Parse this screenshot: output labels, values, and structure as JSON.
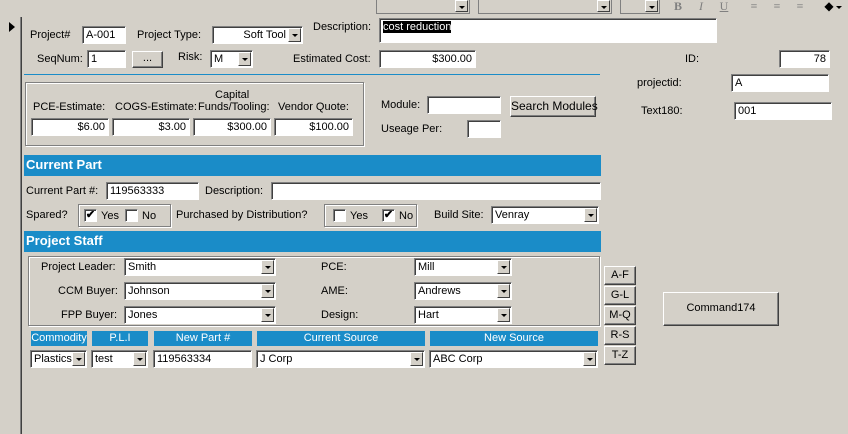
{
  "project": {
    "number_label": "Project#",
    "number": "A-001",
    "type_label": "Project Type:",
    "type": "Soft Tool",
    "description_label": "Description:",
    "description": "cost reduction",
    "seqnum_label": "SeqNum:",
    "seqnum": "1",
    "seq_button": "...",
    "risk_label": "Risk:",
    "risk": "M",
    "estimated_cost_label": "Estimated Cost:",
    "estimated_cost": "$300.00"
  },
  "right_panel": {
    "id_label": "ID:",
    "id": "78",
    "projectid_label": "projectid:",
    "projectid": "A",
    "text180_label": "Text180:",
    "text180": "001",
    "command_button": "Command174"
  },
  "estimates": {
    "pce_label": "PCE-Estimate:",
    "pce": "$6.00",
    "cogs_label": "COGS-Estimate:",
    "cogs": "$3.00",
    "capital_label_1": "Capital",
    "capital_label_2": "Funds/Tooling:",
    "capital": "$300.00",
    "vendor_label": "Vendor Quote:",
    "vendor": "$100.00"
  },
  "module": {
    "module_label": "Module:",
    "module": "",
    "search_button": "Search Modules",
    "useage_label": "Useage Per:",
    "useage": ""
  },
  "current_part": {
    "header": "Current Part",
    "part_label": "Current Part #:",
    "part": "119563333",
    "description_label": "Description:",
    "description": "",
    "spared_label": "Spared?",
    "spared_yes": "Yes",
    "spared_no": "No",
    "spared_yes_checked": "✔",
    "spared_no_checked": "",
    "purchased_label": "Purchased by Distribution?",
    "purchased_yes": "Yes",
    "purchased_no": "No",
    "purchased_yes_checked": "",
    "purchased_no_checked": "✔",
    "build_site_label": "Build Site:",
    "build_site": "Venray"
  },
  "staff": {
    "header": "Project Staff",
    "leader_label": "Project Leader:",
    "leader": "Smith",
    "ccm_label": "CCM Buyer:",
    "ccm": "Johnson",
    "fpp_label": "FPP Buyer:",
    "fpp": "Jones",
    "pce_label": "PCE:",
    "pce": "Mill",
    "ame_label": "AME:",
    "ame": "Andrews",
    "design_label": "Design:",
    "design": "Hart"
  },
  "alpha_buttons": [
    "A-F",
    "G-L",
    "M-Q",
    "R-S",
    "T-Z"
  ],
  "commodity_table": {
    "headers": [
      "Commodity",
      "P.L.I",
      "New Part #",
      "Current Source",
      "New Source"
    ],
    "row": [
      "Plastics",
      "test",
      "119563334",
      "J Corp",
      "ABC Corp"
    ]
  },
  "toolbar": {
    "bold": "B",
    "italic": "I",
    "underline": "U"
  },
  "colors": {
    "accent": "#1a8cc8",
    "face": "#d4d0c8"
  }
}
